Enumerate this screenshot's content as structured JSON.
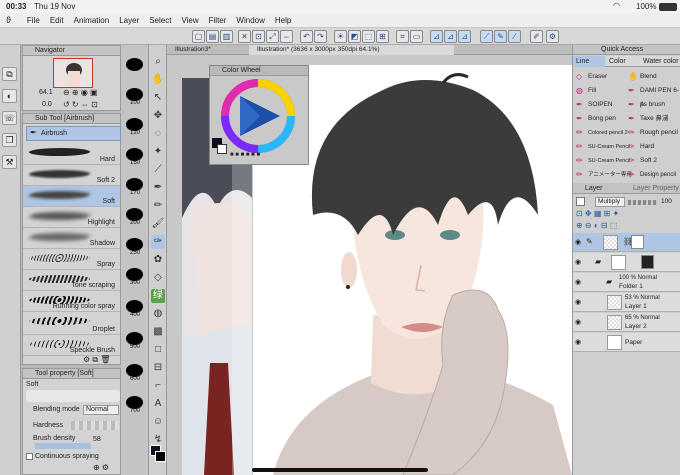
{
  "status": {
    "time": "00:33",
    "date": "Thu 19 Nov",
    "battery": "100%"
  },
  "menu": [
    "File",
    "Edit",
    "Animation",
    "Layer",
    "Select",
    "View",
    "Filter",
    "Window",
    "Help"
  ],
  "tabs": {
    "tab1": "Illustration3*",
    "tab2": "Illustration* (3636 x 3000px 350dpi 64.1%)"
  },
  "navigator": {
    "title": "Navigator",
    "zoom": "64.1",
    "angle": "0.0"
  },
  "subtool": {
    "title": "Sub Tool [Airbrush]",
    "group": "Airbrush",
    "brushes": [
      "Hard",
      "Soft 2",
      "Soft",
      "Highlight",
      "Shadow",
      "Spray",
      "Tone scraping",
      "Running color spray",
      "Droplet",
      "Speckle Brush"
    ]
  },
  "toolprop": {
    "title": "Tool property [Soft]",
    "name": "Soft",
    "blending_label": "Blending mode",
    "blending_value": "Normal",
    "hardness_label": "Hardness",
    "density_label": "Brush density",
    "density_value": "58",
    "continuous_label": "Continuous spraying"
  },
  "brush_sizes": [
    "",
    "100",
    "120",
    "150",
    "170",
    "200",
    "250",
    "300",
    "400",
    "500",
    "600",
    "700"
  ],
  "colorwheel": {
    "title": "Color Wheel"
  },
  "quickaccess": {
    "title": "Quick Access",
    "tabs": [
      "Line",
      "Color",
      "Water color"
    ],
    "items": [
      "Eraser",
      "Blend",
      "Fill",
      "DAMI PEN 6-A",
      "SOIPEN",
      "ps brush",
      "Bong pen",
      "Taxe 鼻涕",
      "Colored pencil 2",
      "Rough pencil",
      "SU-Cream Pencil",
      "Hard",
      "SU-Cream Pencil",
      "Soft 2",
      "アニメーター専用",
      "Design pencil 2"
    ]
  },
  "layerpanel": {
    "tabs": [
      "Layer",
      "Layer Property"
    ],
    "blend": "Multiply",
    "opacity": "100",
    "layers": [
      {
        "line1": "",
        "line2": ""
      },
      {
        "line1": "",
        "line2": ""
      },
      {
        "line1": "100 % Normal",
        "line2": "Folder 1"
      },
      {
        "line1": "53 % Normal",
        "line2": "Layer 1"
      },
      {
        "line1": "65 % Normal",
        "line2": "Layer 2"
      },
      {
        "line1": "",
        "line2": "Paper"
      }
    ]
  }
}
